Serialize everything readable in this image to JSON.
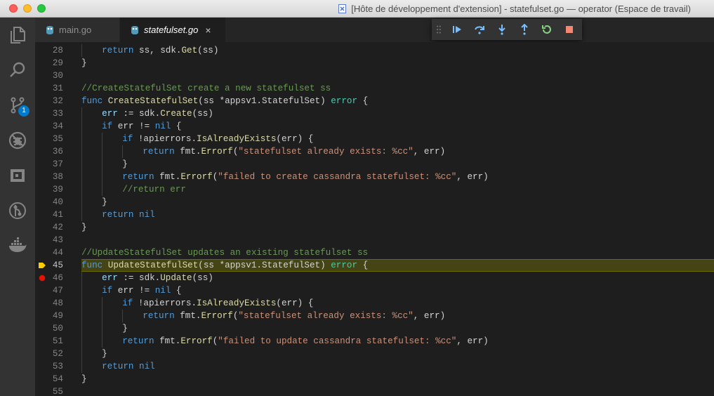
{
  "window": {
    "title": "[Hôte de développement d'extension] - statefulset.go — operator (Espace de travail)"
  },
  "activity_bar": {
    "items": [
      {
        "name": "explorer-icon"
      },
      {
        "name": "search-icon"
      },
      {
        "name": "source-control-icon",
        "badge": "1"
      },
      {
        "name": "debug-icon"
      },
      {
        "name": "extensions-icon"
      },
      {
        "name": "git-graph-icon"
      },
      {
        "name": "docker-icon"
      }
    ]
  },
  "tabs": [
    {
      "label": "main.go",
      "active": false
    },
    {
      "label": "statefulset.go",
      "active": true,
      "close": "×"
    }
  ],
  "debug_toolbar": {
    "buttons": [
      "continue-icon",
      "step-over-icon",
      "step-into-icon",
      "step-out-icon",
      "restart-icon",
      "stop-icon"
    ]
  },
  "editor": {
    "current_line": 45,
    "breakpoint_line": 46,
    "lines": [
      {
        "num": "28",
        "indent": 1,
        "tokens": [
          [
            "k",
            "return"
          ],
          [
            "p",
            " ss, sdk."
          ],
          [
            "f",
            "Get"
          ],
          [
            "p",
            "(ss)"
          ]
        ]
      },
      {
        "num": "29",
        "indent": 0,
        "tokens": [
          [
            "p",
            "}"
          ]
        ]
      },
      {
        "num": "30",
        "indent": 0,
        "tokens": []
      },
      {
        "num": "31",
        "indent": 0,
        "tokens": [
          [
            "c",
            "//CreateStatefulSet create a new statefulset ss"
          ]
        ]
      },
      {
        "num": "32",
        "indent": 0,
        "tokens": [
          [
            "k",
            "func"
          ],
          [
            "p",
            " "
          ],
          [
            "f",
            "CreateStatefulSet"
          ],
          [
            "p",
            "(ss *appsv1.StatefulSet) "
          ],
          [
            "t",
            "error"
          ],
          [
            "p",
            " {"
          ]
        ]
      },
      {
        "num": "33",
        "indent": 1,
        "tokens": [
          [
            "v",
            "err"
          ],
          [
            "p",
            " := sdk."
          ],
          [
            "f",
            "Create"
          ],
          [
            "p",
            "(ss)"
          ]
        ]
      },
      {
        "num": "34",
        "indent": 1,
        "tokens": [
          [
            "k",
            "if"
          ],
          [
            "p",
            " err != "
          ],
          [
            "k",
            "nil"
          ],
          [
            "p",
            " {"
          ]
        ]
      },
      {
        "num": "35",
        "indent": 2,
        "tokens": [
          [
            "k",
            "if"
          ],
          [
            "p",
            " !apierrors."
          ],
          [
            "f",
            "IsAlreadyExists"
          ],
          [
            "p",
            "(err) {"
          ]
        ]
      },
      {
        "num": "36",
        "indent": 3,
        "tokens": [
          [
            "k",
            "return"
          ],
          [
            "p",
            " fmt."
          ],
          [
            "f",
            "Errorf"
          ],
          [
            "p",
            "("
          ],
          [
            "s",
            "\"statefulset already exists: %cc\""
          ],
          [
            "p",
            ", err)"
          ]
        ]
      },
      {
        "num": "37",
        "indent": 2,
        "tokens": [
          [
            "p",
            "}"
          ]
        ]
      },
      {
        "num": "38",
        "indent": 2,
        "tokens": [
          [
            "k",
            "return"
          ],
          [
            "p",
            " fmt."
          ],
          [
            "f",
            "Errorf"
          ],
          [
            "p",
            "("
          ],
          [
            "s",
            "\"failed to create cassandra statefulset: %cc\""
          ],
          [
            "p",
            ", err)"
          ]
        ]
      },
      {
        "num": "39",
        "indent": 2,
        "tokens": [
          [
            "c",
            "//return err"
          ]
        ]
      },
      {
        "num": "40",
        "indent": 1,
        "tokens": [
          [
            "p",
            "}"
          ]
        ]
      },
      {
        "num": "41",
        "indent": 1,
        "tokens": [
          [
            "k",
            "return"
          ],
          [
            "p",
            " "
          ],
          [
            "k",
            "nil"
          ]
        ]
      },
      {
        "num": "42",
        "indent": 0,
        "tokens": [
          [
            "p",
            "}"
          ]
        ]
      },
      {
        "num": "43",
        "indent": 0,
        "tokens": []
      },
      {
        "num": "44",
        "indent": 0,
        "tokens": [
          [
            "c",
            "//UpdateStatefulSet updates an existing statefulset ss"
          ]
        ]
      },
      {
        "num": "45",
        "indent": 0,
        "tokens": [
          [
            "k",
            "func"
          ],
          [
            "p",
            " "
          ],
          [
            "f",
            "UpdateStatefulSet"
          ],
          [
            "p",
            "(ss *appsv1.StatefulSet) "
          ],
          [
            "t",
            "error"
          ],
          [
            "p",
            " {"
          ]
        ]
      },
      {
        "num": "46",
        "indent": 1,
        "tokens": [
          [
            "v",
            "err"
          ],
          [
            "p",
            " := sdk."
          ],
          [
            "f",
            "Update"
          ],
          [
            "p",
            "(ss)"
          ]
        ]
      },
      {
        "num": "47",
        "indent": 1,
        "tokens": [
          [
            "k",
            "if"
          ],
          [
            "p",
            " err != "
          ],
          [
            "k",
            "nil"
          ],
          [
            "p",
            " {"
          ]
        ]
      },
      {
        "num": "48",
        "indent": 2,
        "tokens": [
          [
            "k",
            "if"
          ],
          [
            "p",
            " !apierrors."
          ],
          [
            "f",
            "IsAlreadyExists"
          ],
          [
            "p",
            "(err) {"
          ]
        ]
      },
      {
        "num": "49",
        "indent": 3,
        "tokens": [
          [
            "k",
            "return"
          ],
          [
            "p",
            " fmt."
          ],
          [
            "f",
            "Errorf"
          ],
          [
            "p",
            "("
          ],
          [
            "s",
            "\"statefulset already exists: %cc\""
          ],
          [
            "p",
            ", err)"
          ]
        ]
      },
      {
        "num": "50",
        "indent": 2,
        "tokens": [
          [
            "p",
            "}"
          ]
        ]
      },
      {
        "num": "51",
        "indent": 2,
        "tokens": [
          [
            "k",
            "return"
          ],
          [
            "p",
            " fmt."
          ],
          [
            "f",
            "Errorf"
          ],
          [
            "p",
            "("
          ],
          [
            "s",
            "\"failed to update cassandra statefulset: %cc\""
          ],
          [
            "p",
            ", err)"
          ]
        ]
      },
      {
        "num": "52",
        "indent": 1,
        "tokens": [
          [
            "p",
            "}"
          ]
        ]
      },
      {
        "num": "53",
        "indent": 1,
        "tokens": [
          [
            "k",
            "return"
          ],
          [
            "p",
            " "
          ],
          [
            "k",
            "nil"
          ]
        ]
      },
      {
        "num": "54",
        "indent": 0,
        "tokens": [
          [
            "p",
            "}"
          ]
        ]
      },
      {
        "num": "55",
        "indent": 0,
        "tokens": []
      }
    ]
  }
}
